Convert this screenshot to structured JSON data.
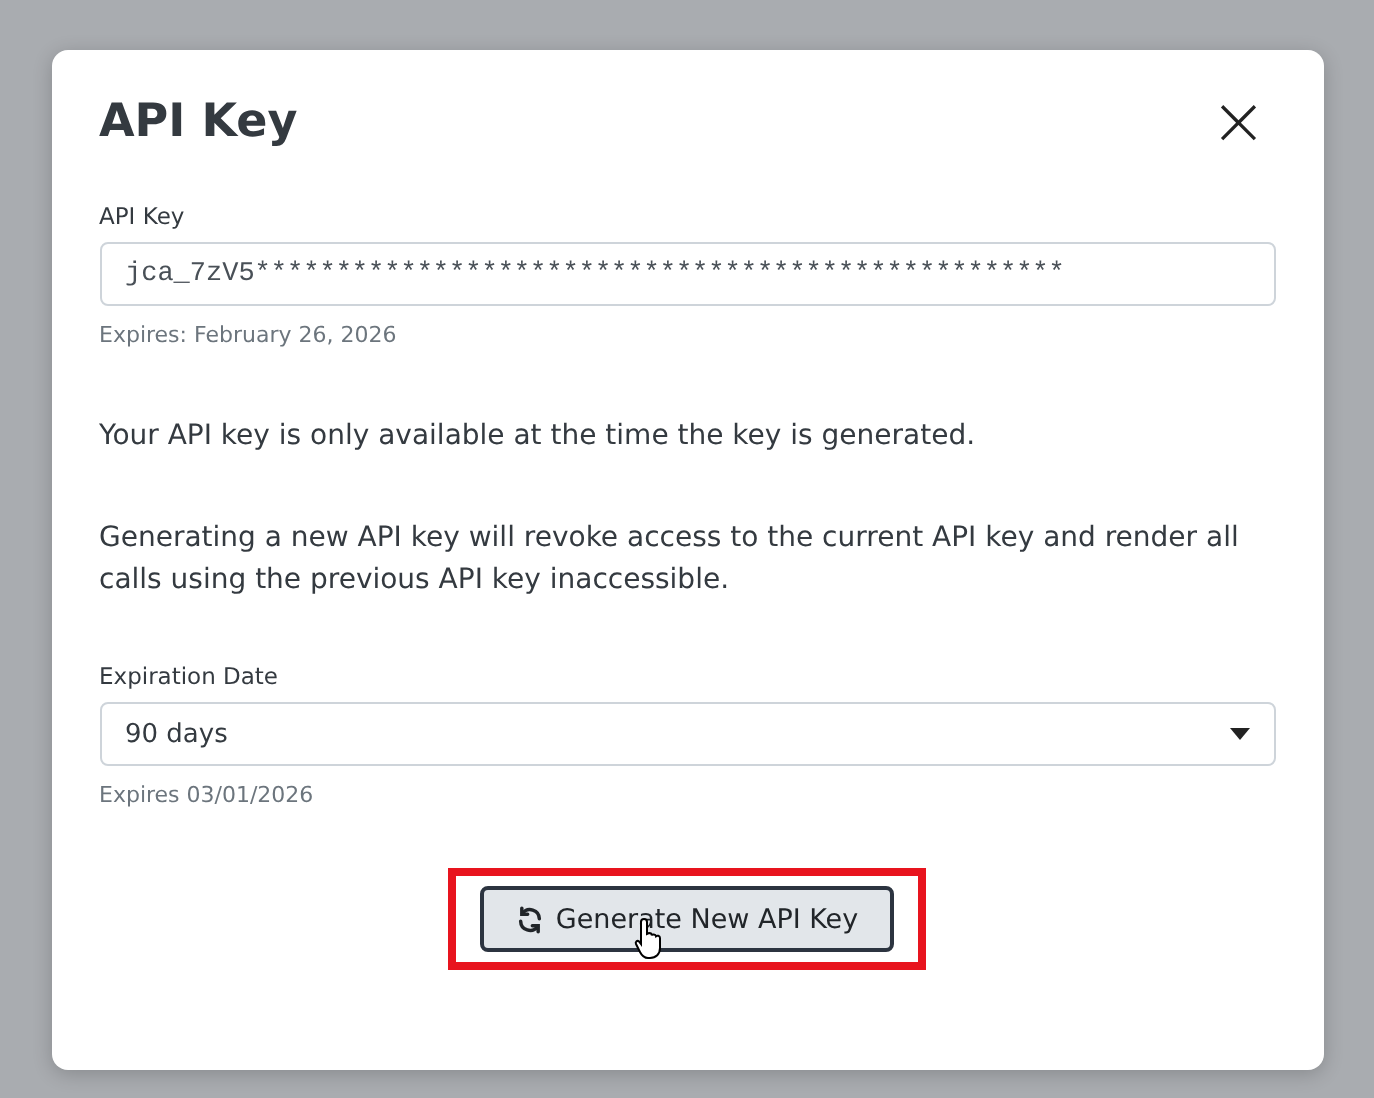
{
  "dialog": {
    "title": "API Key",
    "close_label": "×",
    "api_key": {
      "label": "API Key",
      "value": "jca_7zV5**************************************************",
      "hint": "Expires: February 26, 2026"
    },
    "paragraphs": [
      "Your API key is only available at the time the key is generated.",
      "Generating a new API key will revoke access to the current API key and render all calls using the previous API key inaccessible."
    ],
    "expiration": {
      "label": "Expiration Date",
      "value": "90 days",
      "hint": "Expires 03/01/2026"
    },
    "generate_button": {
      "label": "Generate New API Key",
      "highlighted": true
    }
  }
}
